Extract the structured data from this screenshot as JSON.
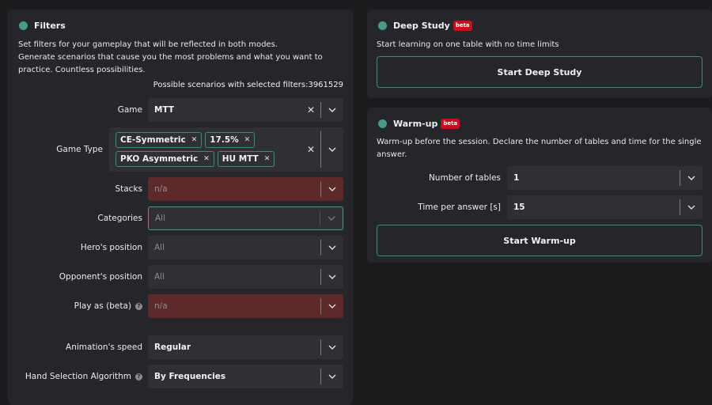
{
  "filters": {
    "title": "Filters",
    "description_lines": [
      "Set filters for your gameplay that will be reflected in both modes.",
      "Generate scenarios that cause you the most problems and what you want to",
      "practice. Countless possibilities."
    ],
    "possible_label": "Possible scenarios with selected filters:",
    "possible_count": "3961529",
    "game": {
      "label": "Game",
      "value": "MTT"
    },
    "game_type": {
      "label": "Game Type",
      "chips": [
        "CE-Symmetric",
        "17.5%",
        "PKO Asymmetric",
        "HU MTT"
      ]
    },
    "stacks": {
      "label": "Stacks",
      "placeholder": "n/a"
    },
    "categories": {
      "label": "Categories",
      "placeholder": "All"
    },
    "heros_position": {
      "label": "Hero's position",
      "placeholder": "All"
    },
    "opponents_position": {
      "label": "Opponent's position",
      "placeholder": "All"
    },
    "play_as": {
      "label": "Play as (beta)",
      "placeholder": "n/a"
    },
    "animation_speed": {
      "label": "Animation's speed",
      "value": "Regular"
    },
    "hand_selection": {
      "label": "Hand Selection Algorithm",
      "value": "By Frequencies"
    }
  },
  "deep_study": {
    "title": "Deep Study",
    "badge": "beta",
    "description": "Start learning on one table with no time limits",
    "button": "Start Deep Study"
  },
  "warmup": {
    "title": "Warm-up",
    "badge": "beta",
    "description_lines": [
      "Warm-up before the session. Declare the number of tables and time for the single",
      "answer."
    ],
    "tables": {
      "label": "Number of tables",
      "value": "1"
    },
    "time": {
      "label": "Time per answer [s]",
      "value": "15"
    },
    "button": "Start Warm-up"
  },
  "icons": {
    "clear": "close-icon",
    "dropdown": "chevron-down-icon",
    "help": "help-icon"
  },
  "colors": {
    "background": "#1b1c1e",
    "panel": "#252629",
    "input": "#2e3034",
    "error_input": "#5d2a29",
    "accent": "#4a9a8b",
    "beta_badge": "#c4121d"
  }
}
